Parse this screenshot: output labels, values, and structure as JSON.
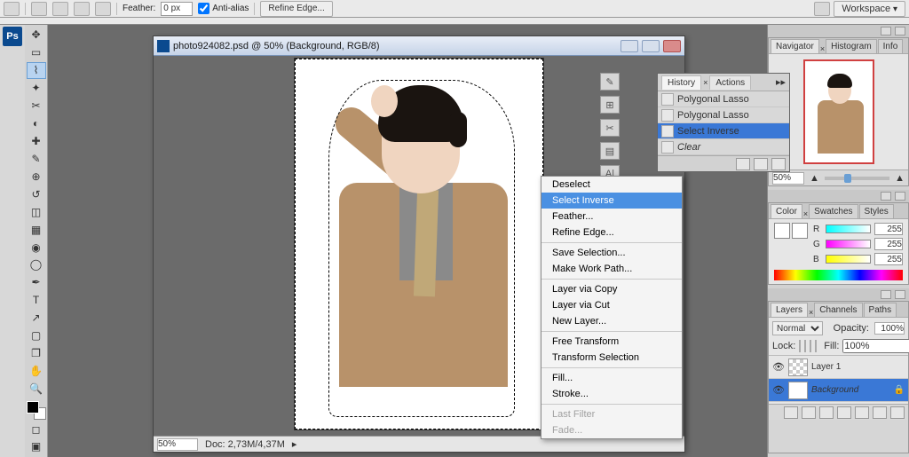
{
  "topbar": {
    "feather_label": "Feather:",
    "feather_val": "0 px",
    "antialias": "Anti-alias",
    "refine": "Refine Edge...",
    "workspace": "Workspace"
  },
  "doc": {
    "title": "photo924082.psd @ 50% (Background, RGB/8)"
  },
  "status": {
    "zoom": "50%",
    "doc": "Doc: 2,73M/4,37M"
  },
  "context": {
    "items": [
      {
        "label": "Deselect",
        "disabled": false
      },
      {
        "label": "Select Inverse",
        "selected": true
      },
      {
        "label": "Feather...",
        "disabled": false
      },
      {
        "label": "Refine Edge...",
        "disabled": false
      },
      {
        "sep": true
      },
      {
        "label": "Save Selection...",
        "disabled": false
      },
      {
        "label": "Make Work Path...",
        "disabled": false
      },
      {
        "sep": true
      },
      {
        "label": "Layer via Copy",
        "disabled": false
      },
      {
        "label": "Layer via Cut",
        "disabled": false
      },
      {
        "label": "New Layer...",
        "disabled": false
      },
      {
        "sep": true
      },
      {
        "label": "Free Transform",
        "disabled": false
      },
      {
        "label": "Transform Selection",
        "disabled": false
      },
      {
        "sep": true
      },
      {
        "label": "Fill...",
        "disabled": false
      },
      {
        "label": "Stroke...",
        "disabled": false
      },
      {
        "sep": true
      },
      {
        "label": "Last Filter",
        "disabled": true
      },
      {
        "label": "Fade...",
        "disabled": true
      }
    ]
  },
  "history": {
    "tabs": [
      "History",
      "Actions"
    ],
    "items": [
      {
        "label": "Polygonal Lasso"
      },
      {
        "label": "Polygonal Lasso"
      },
      {
        "label": "Select Inverse",
        "selected": true
      },
      {
        "label": "Clear",
        "disabled": true
      }
    ]
  },
  "navigator": {
    "tabs": [
      "Navigator",
      "Histogram",
      "Info"
    ],
    "zoom": "50%"
  },
  "color": {
    "tabs": [
      "Color",
      "Swatches",
      "Styles"
    ],
    "r": "255",
    "g": "255",
    "b": "255"
  },
  "layers": {
    "tabs": [
      "Layers",
      "Channels",
      "Paths"
    ],
    "mode": "Normal",
    "opacity_label": "Opacity:",
    "opacity": "100%",
    "lock_label": "Lock:",
    "fill_label": "Fill:",
    "fill": "100%",
    "items": [
      {
        "name": "Layer 1"
      },
      {
        "name": "Background",
        "selected": true,
        "locked": true
      }
    ]
  }
}
